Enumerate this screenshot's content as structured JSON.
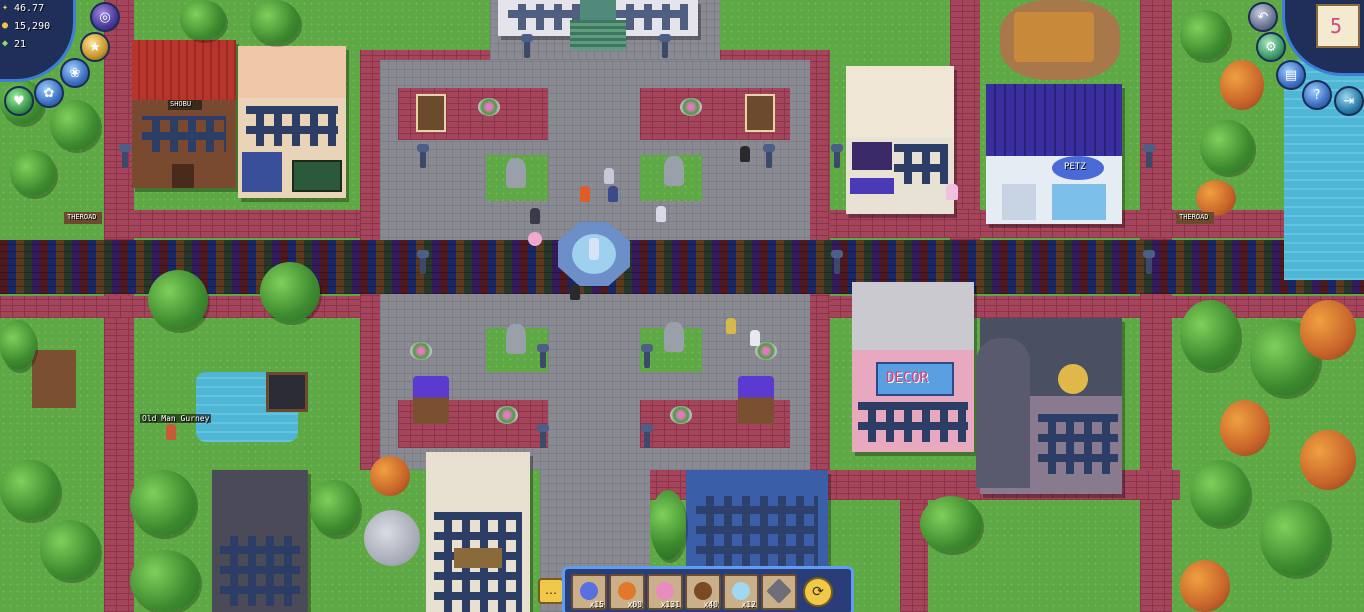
{
  "hud": {
    "health_value": "46.77",
    "coins_value": "15,290",
    "gems_value": "21",
    "calendar_day": "5",
    "icons": [
      "orb-icon",
      "star-badge-icon",
      "pet-icon",
      "paw-icon",
      "heart-icon",
      "settings-gear-icon",
      "book-icon",
      "help-icon",
      "back-arrow-icon",
      "calendar-icon"
    ]
  },
  "world": {
    "signs": {
      "road_sign_left": "THEROAD",
      "road_sign_right": "THEROAD",
      "house_sign": "SHOBU",
      "decor_shop_sign": "DECOR",
      "pet_shop_sign": "PETZ",
      "npc_name": "Old Man Gurney"
    }
  },
  "hotbar": {
    "slots": [
      {
        "name": "blue-berry-item",
        "count": "x15",
        "color": "#5a6fe0"
      },
      {
        "name": "pumpkin-item",
        "count": "x00",
        "color": "#e07a2a"
      },
      {
        "name": "candy-item",
        "count": "x131",
        "color": "#e88bc0"
      },
      {
        "name": "acorn-item",
        "count": "x40",
        "color": "#7a4a24"
      },
      {
        "name": "crystal-item",
        "count": "x12",
        "color": "#9fd8f0"
      },
      {
        "name": "hammer-item",
        "count": "",
        "color": "#6e6e78"
      }
    ],
    "colors": {
      "frame": "#5e9df0",
      "background": "#2a3d78"
    }
  }
}
